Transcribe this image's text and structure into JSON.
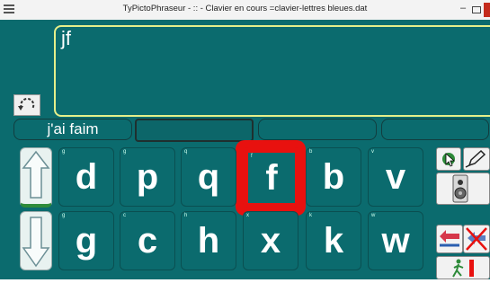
{
  "window": {
    "title": "TyPictoPhraseur  - :: -  Clavier en cours =clavier-lettres bleues.dat",
    "minimize_label": "–"
  },
  "editor": {
    "text": "jf"
  },
  "suggestions": [
    {
      "label": "j'ai faim"
    },
    {
      "label": ""
    },
    {
      "label": ""
    },
    {
      "label": ""
    }
  ],
  "keys": [
    {
      "label": "d",
      "tag": "g"
    },
    {
      "label": "p",
      "tag": "g"
    },
    {
      "label": "q",
      "tag": "q"
    },
    {
      "label": "f",
      "tag": "f"
    },
    {
      "label": "b",
      "tag": "b"
    },
    {
      "label": "v",
      "tag": "v"
    },
    {
      "label": "g",
      "tag": "g"
    },
    {
      "label": "c",
      "tag": "c"
    },
    {
      "label": "h",
      "tag": "h"
    },
    {
      "label": "x",
      "tag": "x"
    },
    {
      "label": "k",
      "tag": "k"
    },
    {
      "label": "w",
      "tag": "w"
    }
  ],
  "colors": {
    "background": "#0b6b6e",
    "text_border": "#e6ef8a",
    "highlight": "#e8110f",
    "arrow_accent": "#2e8b3a"
  },
  "icons": [
    "menu-icon",
    "reload-icon",
    "arrow-up-icon",
    "arrow-down-icon",
    "cursor-icon",
    "pencil-icon",
    "speaker-icon",
    "backspace-icon",
    "clear-icon",
    "exit-icon"
  ]
}
